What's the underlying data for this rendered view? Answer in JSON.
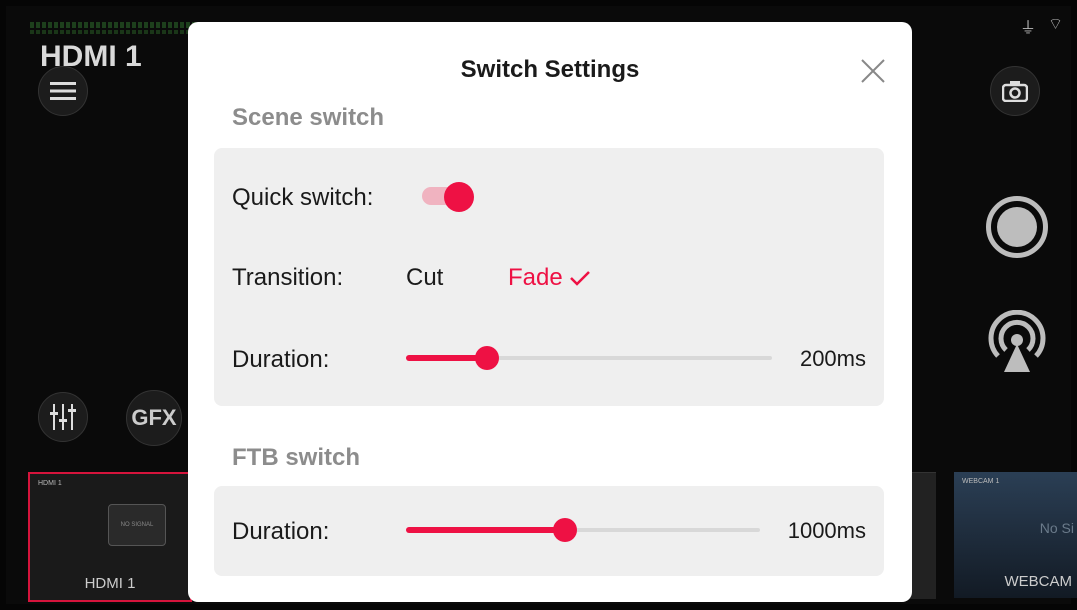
{
  "background": {
    "source_title": "HDMI 1",
    "gfx_label": "GFX",
    "thumbnails": [
      {
        "caption": "HDMI 1",
        "label": "HDMI 1",
        "device_text": "NO SIGNAL"
      },
      {
        "caption": "WEBCAM 1",
        "label": "WEBCAM",
        "no_signal": "No Si"
      }
    ]
  },
  "dialog": {
    "title": "Switch Settings",
    "scene_switch": {
      "heading": "Scene switch",
      "quick_switch_label": "Quick switch:",
      "quick_switch_on": true,
      "transition_label": "Transition:",
      "transition_options": [
        "Cut",
        "Fade"
      ],
      "transition_selected": "Fade",
      "duration_label": "Duration:",
      "duration_value": "200ms",
      "duration_fraction": 0.22
    },
    "ftb_switch": {
      "heading": "FTB switch",
      "duration_label": "Duration:",
      "duration_value": "1000ms",
      "duration_fraction": 0.45
    }
  },
  "colors": {
    "accent": "#ee1144",
    "card": "#efefef",
    "muted_heading": "#8c8c8c"
  }
}
